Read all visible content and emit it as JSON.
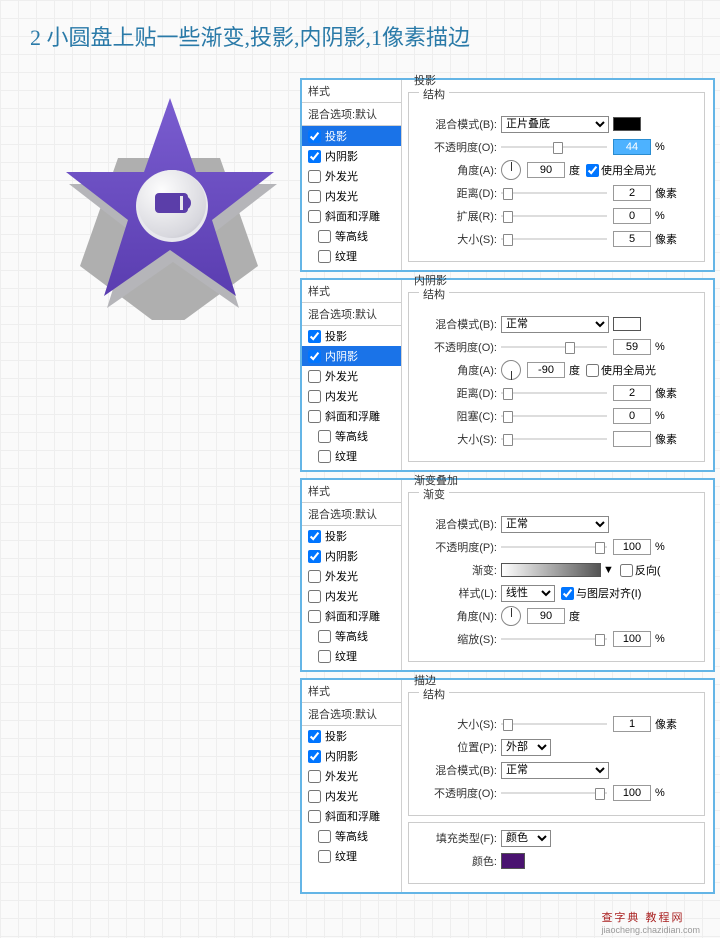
{
  "title": "2 小圆盘上贴一些渐变,投影,内阴影,1像素描边",
  "styleHeader": "样式",
  "blendDefault": "混合选项:默认",
  "styleItems": {
    "dropShadow": "投影",
    "innerShadow": "内阴影",
    "outerGlow": "外发光",
    "innerGlow": "内发光",
    "bevelEmboss": "斜面和浮雕",
    "contour": "等高线",
    "texture": "纹理"
  },
  "labels": {
    "blendMode": "混合模式(B):",
    "opacity": "不透明度(O):",
    "opacityP": "不透明度(P):",
    "angle": "角度(A):",
    "angleN": "角度(N):",
    "distance": "距离(D):",
    "spread": "扩展(R):",
    "choke": "阻塞(C):",
    "size": "大小(S):",
    "useGlobal": "使用全局光",
    "gradient": "渐变:",
    "reverse": "反向(",
    "style": "样式(L):",
    "alignLayer": "与图层对齐(I)",
    "scale": "缩放(S):",
    "position": "位置(P):",
    "fillType": "填充类型(F):",
    "color": "颜色:"
  },
  "units": {
    "deg": "度",
    "px": "像素",
    "pct": "%"
  },
  "dropdowns": {
    "multiply": "正片叠底",
    "normal": "正常",
    "linear": "线性",
    "outside": "外部",
    "colorFill": "颜色"
  },
  "sections": {
    "dropShadow": "投影",
    "innerShadow": "内阴影",
    "gradientOverlay": "渐变叠加",
    "stroke": "描边",
    "structure": "结构",
    "gradient": "渐变"
  },
  "values": {
    "p1": {
      "opacity": "44",
      "angle": "90",
      "distance": "2",
      "spread": "0",
      "size": "5"
    },
    "p2": {
      "opacity": "59",
      "angle": "-90",
      "distance": "2",
      "choke": "0",
      "size": ""
    },
    "p3": {
      "opacity": "100",
      "angle": "90",
      "scale": "100"
    },
    "p4": {
      "size": "1",
      "opacity": "100"
    }
  },
  "footer": {
    "brand": "查字典 教程网",
    "url": "jiaocheng.chazidian.com"
  }
}
